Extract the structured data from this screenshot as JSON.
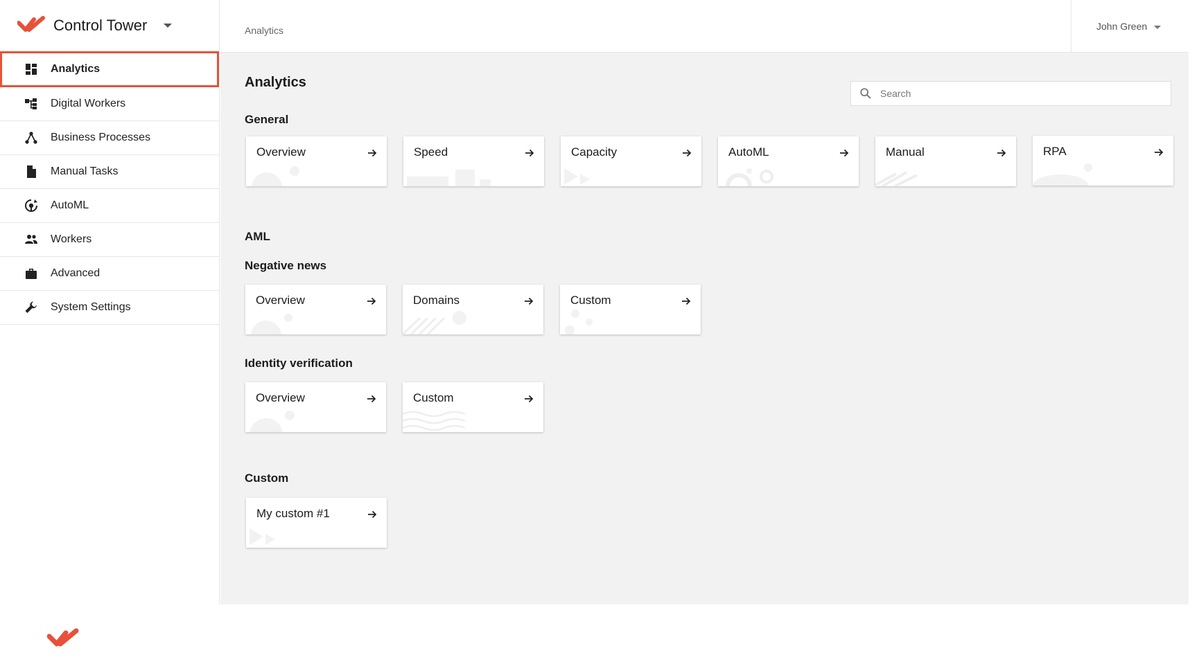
{
  "app": {
    "title": "Control Tower",
    "accent_color": "#e8513a"
  },
  "sidebar": {
    "items": [
      {
        "label": "Analytics",
        "icon": "dashboard-icon",
        "active": true
      },
      {
        "label": "Digital Workers",
        "icon": "hierarchy-icon"
      },
      {
        "label": "Business Processes",
        "icon": "process-graph-icon"
      },
      {
        "label": "Manual Tasks",
        "icon": "document-icon"
      },
      {
        "label": "AutoML",
        "icon": "brain-gear-icon"
      },
      {
        "label": "Workers",
        "icon": "people-icon"
      },
      {
        "label": "Advanced",
        "icon": "briefcase-icon"
      },
      {
        "label": "System Settings",
        "icon": "wrench-icon"
      }
    ]
  },
  "topbar": {
    "breadcrumb": "Analytics",
    "user_name": "John Green"
  },
  "main": {
    "title": "Analytics",
    "search": {
      "placeholder": "Search",
      "value": ""
    },
    "sections": {
      "general": {
        "title": "General",
        "cards": [
          "Overview",
          "Speed",
          "Capacity",
          "AutoML",
          "Manual",
          "RPA"
        ]
      },
      "aml": {
        "title": "AML",
        "negative_news": {
          "title": "Negative news",
          "cards": [
            "Overview",
            "Domains",
            "Custom"
          ]
        },
        "identity_verification": {
          "title": "Identity verification",
          "cards": [
            "Overview",
            "Custom"
          ]
        }
      },
      "custom": {
        "title": "Custom",
        "cards": [
          "My custom #1"
        ]
      }
    }
  }
}
